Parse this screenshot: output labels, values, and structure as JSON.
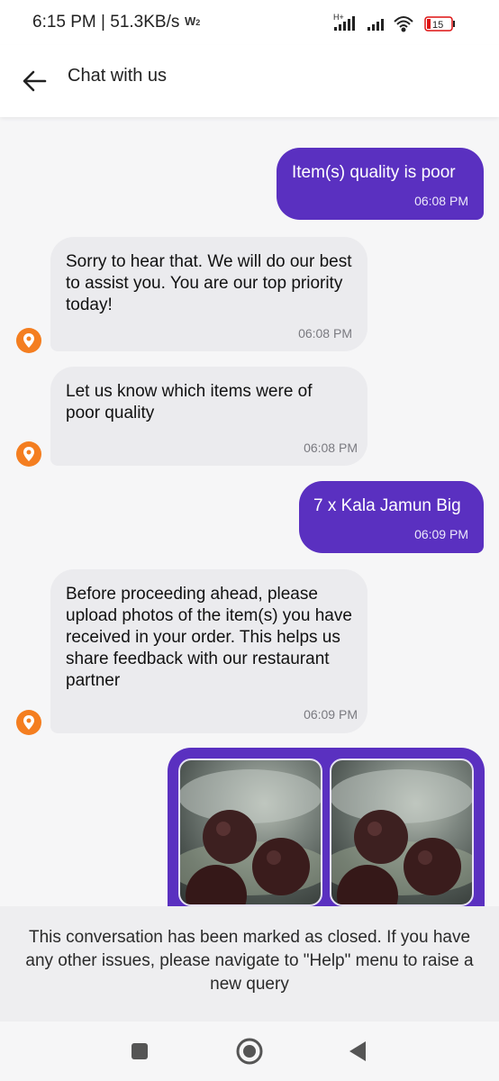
{
  "status_bar": {
    "time_speed": "6:15 PM | 51.3KB/s",
    "battery": "15",
    "network": "H+"
  },
  "header": {
    "title": "Chat with us"
  },
  "messages": [
    {
      "from": "user",
      "text": "Item(s) quality is poor",
      "time": "06:08 PM"
    },
    {
      "from": "support",
      "text": "Sorry to hear that. We will do our best to assist you. You are our top priority today!",
      "time": "06:08 PM"
    },
    {
      "from": "support",
      "text": "Let us know which items were of poor quality",
      "time": "06:08 PM"
    },
    {
      "from": "user",
      "text": "7 x Kala Jamun Big",
      "time": "06:09 PM"
    },
    {
      "from": "support",
      "text": "Before proceeding ahead, please upload photos of the item(s) you have received in your order. This helps us share feedback with our restaurant partner",
      "time": "06:09 PM"
    }
  ],
  "photos_message": {
    "from": "user",
    "images": [
      "kala-jamun-photo-1",
      "kala-jamun-photo-2"
    ]
  },
  "closed_notice": "This conversation has been marked as closed. If you have any other issues, please navigate to \"Help\" menu to raise a new query",
  "colors": {
    "user_bubble": "#5a30c0",
    "support_bubble": "#ebebee",
    "brand_avatar": "#f47e20",
    "banner": "#eeeef0"
  }
}
